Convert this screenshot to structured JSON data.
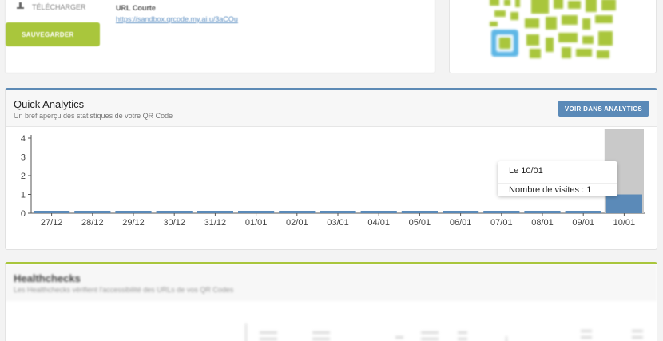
{
  "top": {
    "download_label": "TÉLÉCHARGER",
    "save_label": "SAUVEGARDER",
    "url_label": "URL Courte",
    "url_value": "https://sandbox.qrcode.my.ai.u/3aCOu"
  },
  "analytics": {
    "title": "Quick Analytics",
    "subtitle": "Un bref aperçu des statistiques de votre QR Code",
    "button_label": "VOIR DANS ANALYTICS",
    "accent": "#5d8ab5"
  },
  "tooltip": {
    "date_label": "Le 10/01",
    "visits_label": "Nombre de visites : 1"
  },
  "healthchecks": {
    "title": "Healthchecks",
    "subtitle": "Les Healthchecks vérifient l'accessibilité des URLs de vos QR Codes",
    "accent": "#a9c63c"
  },
  "chart_data": {
    "type": "bar",
    "categories": [
      "27/12",
      "28/12",
      "29/12",
      "30/12",
      "31/12",
      "01/01",
      "02/01",
      "03/01",
      "04/01",
      "05/01",
      "06/01",
      "07/01",
      "08/01",
      "09/01",
      "10/01"
    ],
    "series": [
      {
        "values": [
          0,
          0,
          0,
          0,
          0,
          0,
          0,
          0,
          0,
          0,
          0,
          0,
          0,
          0,
          1
        ]
      }
    ],
    "y_ticks": [
      "0",
      "1",
      "2",
      "3",
      "4"
    ],
    "ylim": [
      0,
      4
    ],
    "highlighted_category": "10/01",
    "bar_color": "#5b8ab8"
  }
}
